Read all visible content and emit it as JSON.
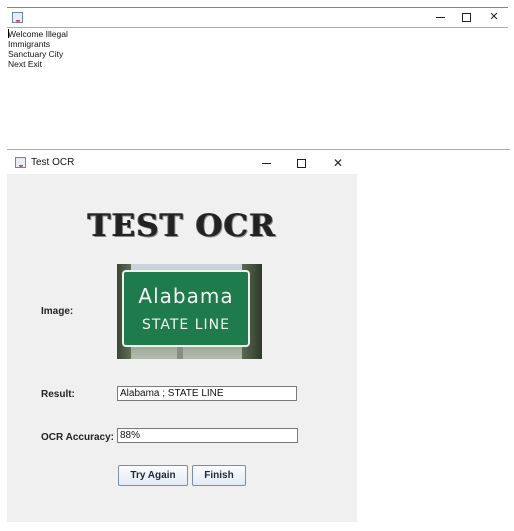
{
  "editor_window": {
    "lines": [
      "Welcome Illegal",
      "Immigrants",
      "Sanctuary City",
      "Next Exit"
    ]
  },
  "ocr_window": {
    "title": "Test OCR",
    "heading": "TEST OCR",
    "image_label": "Image:",
    "image_text": {
      "line1": "Alabama",
      "line2": "STATE LINE"
    },
    "result_label": "Result:",
    "result_value": "Alabama ; STATE LINE",
    "accuracy_label": "OCR Accuracy:",
    "accuracy_value": "88%",
    "try_again_label": "Try Again",
    "finish_label": "Finish"
  },
  "colors": {
    "sign_green": "#1e7b4c",
    "window_bg": "#f0f0f0",
    "button_border": "#7a8ea6"
  },
  "icons": {
    "app": "java-cup-icon",
    "minimize": "minimize-icon",
    "maximize": "maximize-icon",
    "close": "close-icon"
  }
}
